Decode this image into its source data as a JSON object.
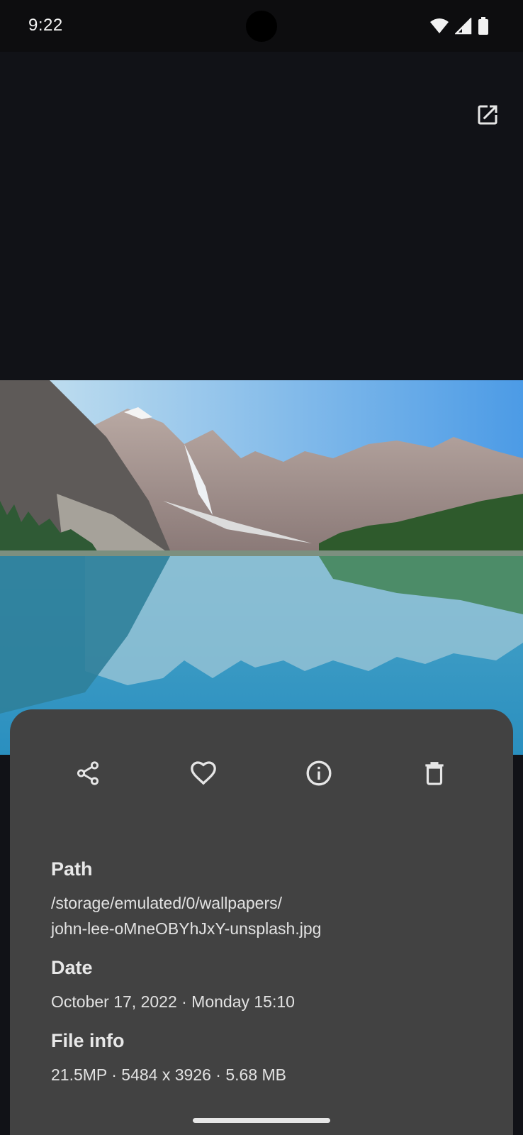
{
  "status_bar": {
    "time": "9:22",
    "icons": [
      "wifi-icon",
      "cell-signal-icon",
      "battery-icon"
    ]
  },
  "toolbar": {
    "open_external_icon": "open-in-new-icon"
  },
  "actions": [
    {
      "name": "share",
      "icon": "share-icon"
    },
    {
      "name": "favorite",
      "icon": "heart-outline-icon"
    },
    {
      "name": "info",
      "icon": "info-icon"
    },
    {
      "name": "delete",
      "icon": "trash-icon"
    }
  ],
  "details": {
    "path_label": "Path",
    "path_line1": "/storage/emulated/0/wallpapers/",
    "path_line2": "john-lee-oMneOBYhJxY-unsplash.jpg",
    "date_label": "Date",
    "date_value": "October 17, 2022 · Monday 15:10",
    "file_info_label": "File info",
    "file_info_value": "21.5MP · 5484 x 3926 · 5.68 MB"
  },
  "colors": {
    "background": "#111217",
    "sheet": "#424242",
    "icon": "#e6e6e6"
  }
}
